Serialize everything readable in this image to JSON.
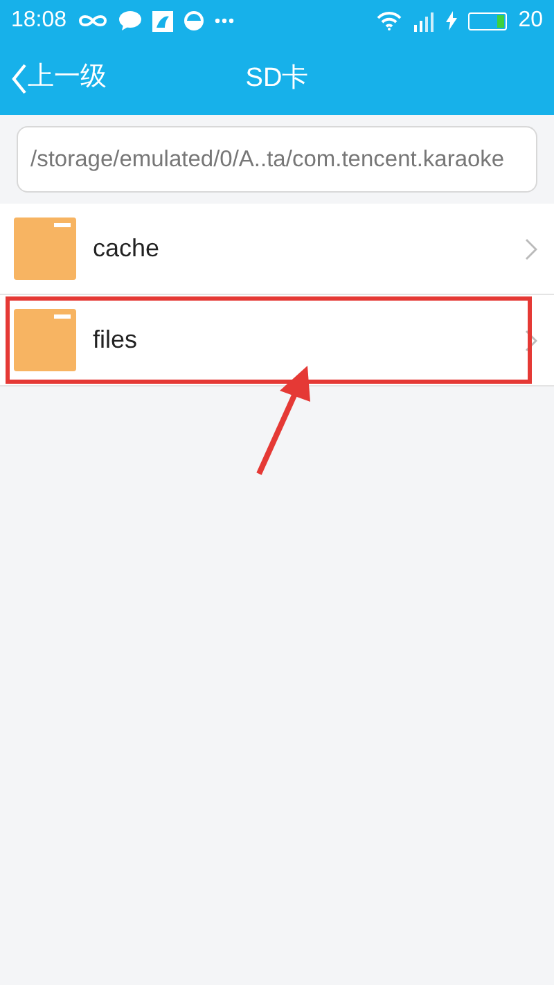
{
  "status_bar": {
    "time": "18:08",
    "battery_text": "20"
  },
  "header": {
    "back_label": "上一级",
    "title": "SD卡"
  },
  "path": {
    "value": "/storage/emulated/0/A..ta/com.tencent.karaoke"
  },
  "folders": [
    {
      "name": "cache",
      "highlighted": false
    },
    {
      "name": "files",
      "highlighted": true
    }
  ],
  "annotation": {
    "arrow": true
  }
}
